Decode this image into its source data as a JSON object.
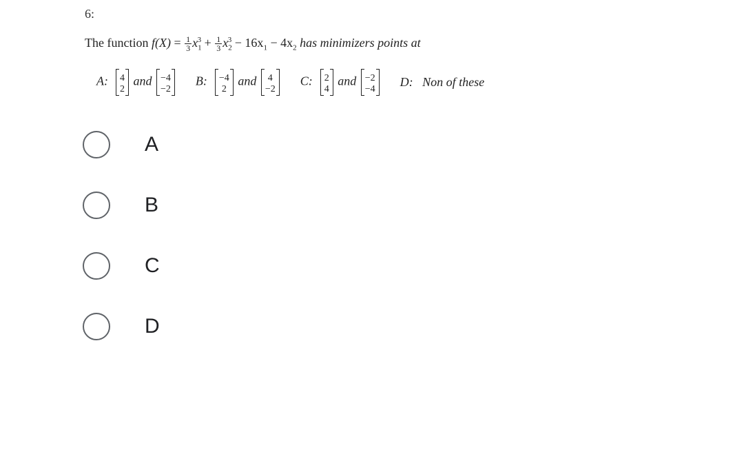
{
  "question": {
    "number": "6:",
    "prefix": "The function ",
    "function_name": "f(X)",
    "eq": " = ",
    "frac1_num": "1",
    "frac1_den": "3",
    "term1": "x",
    "term1_sub": "1",
    "term1_sup": "3",
    "plus": " + ",
    "frac2_num": "1",
    "frac2_den": "3",
    "term2": "x",
    "term2_sub": "2",
    "term2_sup": "3",
    "minus1": " − 16x",
    "term3_sub": "1",
    "minus2": " − 4x",
    "term4_sub": "2",
    "suffix": " has minimizers points at"
  },
  "options": {
    "A": {
      "label": "A:",
      "m1": [
        "4",
        "2"
      ],
      "and": "and",
      "m2": [
        "−4",
        "−2"
      ]
    },
    "B": {
      "label": "B:",
      "m1": [
        "−4",
        "2"
      ],
      "and": "and",
      "m2": [
        "4",
        "−2"
      ]
    },
    "C": {
      "label": "C:",
      "m1": [
        "2",
        "4"
      ],
      "and": "and",
      "m2": [
        "−2",
        "−4"
      ]
    },
    "D": {
      "label": "D:",
      "text": "Non of these"
    }
  },
  "answers": {
    "A": "A",
    "B": "B",
    "C": "C",
    "D": "D"
  }
}
